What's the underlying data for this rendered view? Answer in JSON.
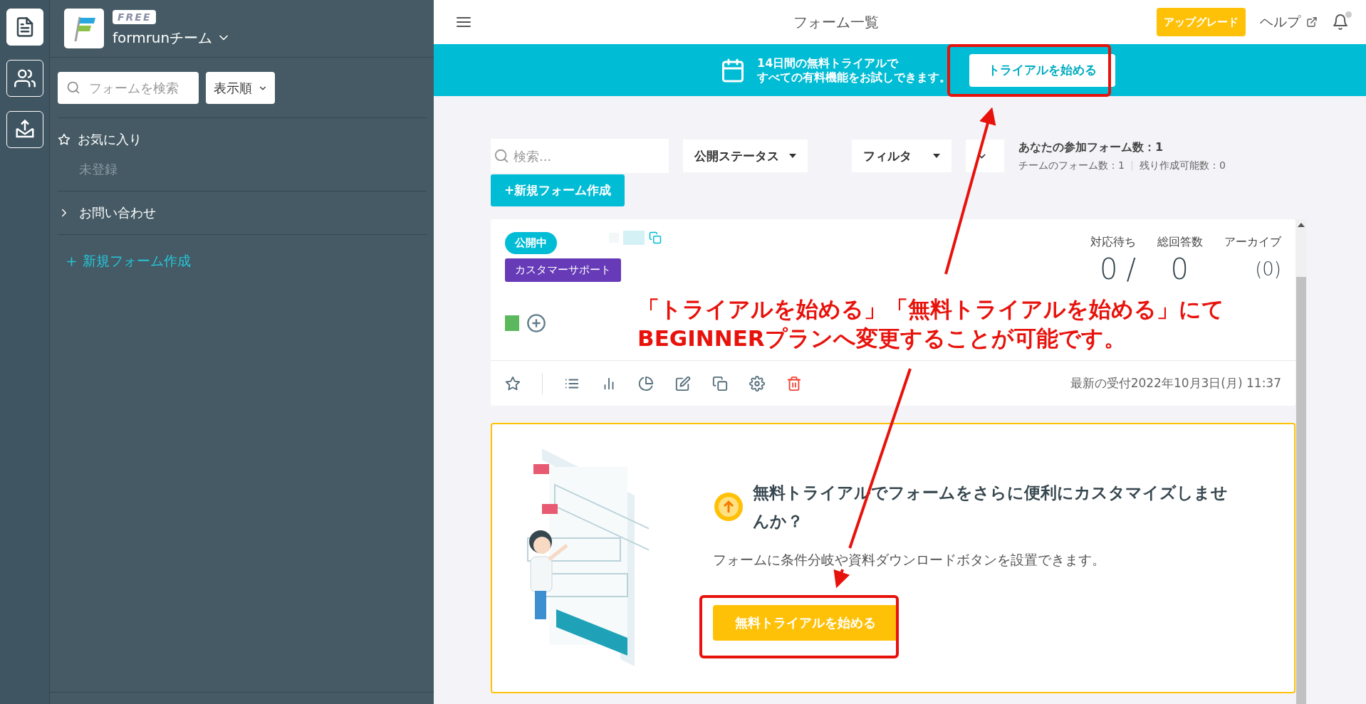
{
  "icon_rail": {
    "items": [
      {
        "selected": true
      },
      {
        "selected": false
      },
      {
        "selected": false
      }
    ]
  },
  "sidebar": {
    "badge": "FREE",
    "team_name": "formrunチーム",
    "search": {
      "placeholder": "フォームを検索"
    },
    "sort_button": "表示順",
    "favorites": {
      "title": "お気に入り",
      "empty_text": "未登録"
    },
    "groups": [
      {
        "label": "お問い合わせ",
        "expanded": false
      }
    ],
    "new_form_link": "新規フォーム作成"
  },
  "header": {
    "title": "フォーム一覧",
    "upgrade_button": "アップグレード",
    "help_link": "ヘルプ"
  },
  "trial_banner": {
    "lines": [
      "14日間の無料トライアルで",
      "すべての有料機能をお試しできます。"
    ],
    "button": "トライアルを始める"
  },
  "toolbar": {
    "search": {
      "placeholder": "検索..."
    },
    "filters": [
      "公開ステータス",
      "フィルタ"
    ],
    "participating_forms": "あなたの参加フォーム数：1",
    "team_forms": "チームのフォーム数：1",
    "remaining": "残り作成可能数：0",
    "new_form_button": "+新規フォーム作成"
  },
  "form_card": {
    "status": "公開中",
    "tag": "カスタマーサポート",
    "stats": [
      {
        "label": "対応待ち",
        "value": "0"
      },
      {
        "label": "総回答数",
        "value": "0"
      },
      {
        "label": "アーカイブ",
        "value": "(0)"
      }
    ],
    "separator": "/",
    "last_received": "最新の受付2022年10月3日(月) 11:37"
  },
  "promo_card": {
    "title": "無料トライアルでフォームをさらに便利にカスタマイズしませんか？",
    "description": "フォームに条件分岐や資料ダウンロードボタンを設置できます。",
    "button": "無料トライアルを始める"
  },
  "annotation": {
    "lines": [
      "「トライアルを始める」「無料トライアルを始める」にて",
      "BEGINNERプランへ変更することが可能です。"
    ]
  }
}
